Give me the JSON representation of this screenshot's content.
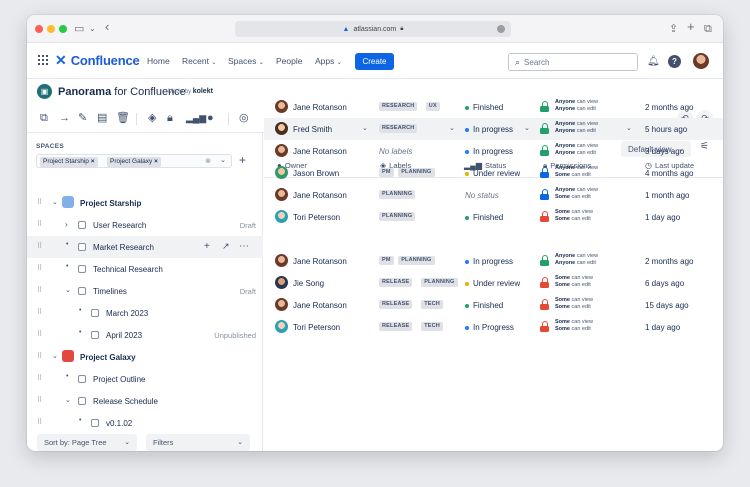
{
  "browser": {
    "url": "atlassian.com"
  },
  "nav": {
    "brand": "Confluence",
    "home": "Home",
    "recent": "Recent",
    "spaces": "Spaces",
    "people": "People",
    "apps": "Apps",
    "create": "Create",
    "search_placeholder": "Search"
  },
  "app": {
    "name_bold": "Panorama",
    "name_rest": " for Confluence",
    "made_by": "Made by",
    "maker": "kolekt"
  },
  "spaces_panel": {
    "label": "SPACES",
    "chips": [
      "Project Starship",
      "Project Galaxy"
    ],
    "tree": [
      {
        "label": "Project Starship",
        "status": ""
      },
      {
        "label": "User Research",
        "status": "Draft"
      },
      {
        "label": "Market Research",
        "status": ""
      },
      {
        "label": "Technical Research",
        "status": ""
      },
      {
        "label": "Timelines",
        "status": "Draft"
      },
      {
        "label": "March 2023",
        "status": ""
      },
      {
        "label": "April 2023",
        "status": "Unpublished"
      },
      {
        "label": "Project Galaxy",
        "status": ""
      },
      {
        "label": "Project Outline",
        "status": ""
      },
      {
        "label": "Release Schedule",
        "status": ""
      },
      {
        "label": "v0.1.02",
        "status": ""
      }
    ],
    "sort_label": "Sort by: Page Tree",
    "filters_label": "Filters"
  },
  "table": {
    "view_label": "Default view",
    "headers": {
      "owner": "Owner",
      "labels": "Labels",
      "status": "Status",
      "permissions": "Permissions",
      "update": "Last update"
    },
    "no_labels": "No labels",
    "rows": [
      {
        "owner": "Jane Rotanson",
        "labels": [
          "RESEARCH",
          "UX"
        ],
        "status": "Finished",
        "perm_a": "Anyone",
        "perm_a_t": " can view",
        "perm_b": "Anyone",
        "perm_b_t": " can  edit",
        "update": "2 months ago"
      },
      {
        "owner": "Fred Smith",
        "labels": [
          "RESEARCH"
        ],
        "status": "In progress",
        "perm_a": "Anyone",
        "perm_a_t": " can view",
        "perm_b": "Anyone",
        "perm_b_t": " can edit",
        "update": "5 hours ago"
      },
      {
        "owner": "Jane Rotanson",
        "labels": [],
        "status": "In progress",
        "perm_a": "Anyone",
        "perm_a_t": " can view",
        "perm_b": "Anyone",
        "perm_b_t": " can edit",
        "update": "3 days ago"
      },
      {
        "owner": "Jason Brown",
        "labels": [
          "PM",
          "PLANNING"
        ],
        "status": "Under review",
        "perm_a": "Anyone",
        "perm_a_t": " can view",
        "perm_b": "Some",
        "perm_b_t": " can edit",
        "update": "4 months ago"
      },
      {
        "owner": "Jane Rotanson",
        "labels": [
          "PLANNING"
        ],
        "status": "No status",
        "perm_a": "Anyone",
        "perm_a_t": " can view",
        "perm_b": "Some",
        "perm_b_t": " can edit",
        "update": "1 month ago"
      },
      {
        "owner": "Tori Peterson",
        "labels": [
          "PLANNING"
        ],
        "status": "Finished",
        "perm_a": "Some",
        "perm_a_t": " can view",
        "perm_b": "Some",
        "perm_b_t": " can edit",
        "update": "1 day ago"
      },
      {
        "owner": "Jane Rotanson",
        "labels": [
          "PM",
          "PLANNING"
        ],
        "status": "In progress",
        "perm_a": "Anyone",
        "perm_a_t": " can view",
        "perm_b": "Anyone",
        "perm_b_t": " can edit",
        "update": "2 months ago"
      },
      {
        "owner": "Jie Song",
        "labels": [
          "RELEASE",
          "PLANNING"
        ],
        "status": "Under review",
        "perm_a": "Some",
        "perm_a_t": " can view",
        "perm_b": "Some",
        "perm_b_t": " can edit",
        "update": "6 days ago"
      },
      {
        "owner": "Jane Rotanson",
        "labels": [
          "RELEASE",
          "TECH"
        ],
        "status": "Finished",
        "perm_a": "Some",
        "perm_a_t": " can view",
        "perm_b": "Some",
        "perm_b_t": " can edit",
        "update": "15 days ago"
      },
      {
        "owner": "Tori Peterson",
        "labels": [
          "RELEASE",
          "TECH"
        ],
        "status": "In Progress",
        "perm_a": "Some",
        "perm_a_t": " can view",
        "perm_b": "Some",
        "perm_b_t": " can edit",
        "update": "1 day ago"
      }
    ]
  },
  "colors": {
    "brand": "#1868db",
    "create": "#0c66e4",
    "finished": "#22a06b",
    "progress": "#1d7afc",
    "review": "#e2b203",
    "lock_green": "#22a06b",
    "lock_blue": "#0c66e4",
    "lock_red": "#e34935"
  }
}
